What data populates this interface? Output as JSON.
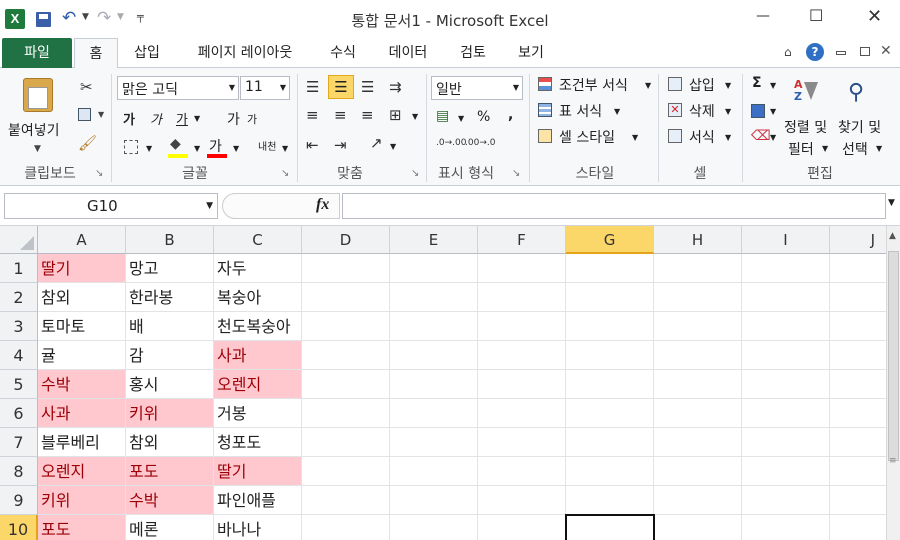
{
  "app": {
    "title": "통합 문서1 - Microsoft Excel"
  },
  "window_controls": {
    "minimize": "—",
    "maximize": "☐",
    "close": "✕"
  },
  "ribbon_tabs": [
    {
      "label": "파일"
    },
    {
      "label": "홈"
    },
    {
      "label": "삽입"
    },
    {
      "label": "페이지 레이아웃"
    },
    {
      "label": "수식"
    },
    {
      "label": "데이터"
    },
    {
      "label": "검토"
    },
    {
      "label": "보기"
    }
  ],
  "clipboard": {
    "paste": "붙여넣기",
    "group": "클립보드"
  },
  "font": {
    "name": "맑은 고딕",
    "size": "11",
    "group": "글꼴",
    "bold": "가",
    "italic": "가",
    "grow": "가",
    "shrink": "가",
    "color_letter": "가",
    "phonetic": "내천"
  },
  "alignment": {
    "group": "맞춤"
  },
  "number": {
    "format": "일반",
    "group": "표시 형식",
    "percent": "%",
    "comma": ","
  },
  "styles": {
    "conditional": "조건부 서식",
    "table": "표 서식",
    "cell": "셀 스타일",
    "group": "스타일"
  },
  "cells": {
    "insert": "삽입",
    "delete": "삭제",
    "format": "서식",
    "group": "셀"
  },
  "editing": {
    "sort": "정렬 및",
    "sort2": "필터",
    "find": "찾기 및",
    "find2": "선택",
    "group": "편집",
    "sum": "Σ"
  },
  "formula_bar": {
    "name_box": "G10",
    "fx": "fx",
    "formula": ""
  },
  "columns": [
    "A",
    "B",
    "C",
    "D",
    "E",
    "F",
    "G",
    "H",
    "I",
    "J"
  ],
  "rows": [
    {
      "num": "1",
      "a": "딸기",
      "b": "망고",
      "c": "자두"
    },
    {
      "num": "2",
      "a": "참외",
      "b": "한라봉",
      "c": "복숭아"
    },
    {
      "num": "3",
      "a": "토마토",
      "b": "배",
      "c": "천도복숭아"
    },
    {
      "num": "4",
      "a": "귤",
      "b": "감",
      "c": "사과"
    },
    {
      "num": "5",
      "a": "수박",
      "b": "홍시",
      "c": "오렌지"
    },
    {
      "num": "6",
      "a": "사과",
      "b": "키위",
      "c": "거봉"
    },
    {
      "num": "7",
      "a": "블루베리",
      "b": "참외",
      "c": "청포도"
    },
    {
      "num": "8",
      "a": "오렌지",
      "b": "포도",
      "c": "딸기"
    },
    {
      "num": "9",
      "a": "키위",
      "b": "수박",
      "c": "파인애플"
    },
    {
      "num": "10",
      "a": "포도",
      "b": "메론",
      "c": "바나나"
    }
  ],
  "highlight_color": "#ffc7ce",
  "highlight_text_color": "#9c0006",
  "selected_cell": "G10"
}
